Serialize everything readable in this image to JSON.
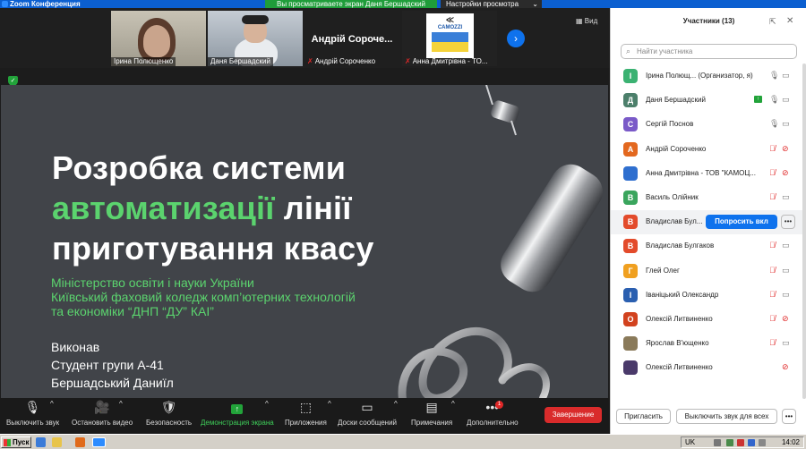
{
  "window": {
    "title": "Zoom Конференция",
    "share_banner": "Вы просматриваете экран Даня Бершадский",
    "view_options": "Настройки просмотра",
    "view_options_caret": "⌄"
  },
  "video_strip": {
    "tiles": [
      {
        "name": "Ірина Полющенко",
        "muted": false
      },
      {
        "name": "Даня Бершадский",
        "muted": false
      },
      {
        "name": "Андрій Сороченко",
        "display": "Андрій Сороче...",
        "muted": true
      },
      {
        "name": "Анна Дмитрівна - ТО...",
        "muted": true,
        "logo_title": "CAMOZZI",
        "logo_mark": "≪"
      }
    ],
    "next_icon": "›",
    "view_label": "Вид",
    "view_icon": "▦"
  },
  "slide": {
    "title_line1": "Розробка системи",
    "title_accent": "автоматизації",
    "title_line2_rest": " лінії",
    "title_line3": "приготування квасу",
    "org_line1": "Міністерство освіти і науки України",
    "org_line2": "Київський фаховий коледж комп’ютерних технологій",
    "org_line3": "та економіки “ДНП “ДУ” КАІ”",
    "author_line1": "Виконав",
    "author_line2": "Студент групи А-41",
    "author_line3": "Бершадський Даниїл"
  },
  "toolbar": {
    "items": [
      {
        "label": "Выключить звук",
        "icon": "🎙"
      },
      {
        "label": "Остановить видео",
        "icon": "🎥"
      },
      {
        "label": "Безопасность",
        "icon": "🛡"
      },
      {
        "label": "Демонстрация экрана",
        "icon": "↑"
      },
      {
        "label": "Приложения",
        "icon": "⬚"
      },
      {
        "label": "Доски сообщений",
        "icon": "▭"
      },
      {
        "label": "Примечания",
        "icon": "▤"
      },
      {
        "label": "Дополнительно",
        "icon": "•••"
      }
    ],
    "more_badge": "1",
    "end_label": "Завершение",
    "caret": "^"
  },
  "participants": {
    "header": "Участники (13)",
    "popout_icon": "⇱",
    "close_icon": "✕",
    "search_placeholder": "Найти участника",
    "search_icon": "⌕",
    "list": [
      {
        "initial": "І",
        "color": "#3bb272",
        "name": "Ірина Полющ...  (Организатор, я)",
        "mic": "on",
        "cam": "on"
      },
      {
        "initial": "Д",
        "color": "#4c7f6b",
        "name": "Даня Бершадский",
        "mic": "on",
        "cam": "on",
        "sharing": true
      },
      {
        "initial": "С",
        "color": "#7a5ac8",
        "name": "Сергій Поснов",
        "mic": "on",
        "cam": "on"
      },
      {
        "initial": "А",
        "color": "#e3681f",
        "name": "Андрій Сороченко",
        "mic": "off",
        "cam": "off"
      },
      {
        "initial": "",
        "color": "#2f6fcf",
        "name": "Анна Дмитрівна - ТОВ \"КАМОЦ...",
        "mic": "off",
        "cam": "off",
        "photo": true
      },
      {
        "initial": "В",
        "color": "#3aa55d",
        "name": "Василь Олійник",
        "mic": "off",
        "cam": "on"
      },
      {
        "initial": "В",
        "color": "#e34b2b",
        "name": "Владислав Бул...",
        "mic": "none",
        "cam": "none",
        "highlight": true,
        "ask": "Попросить вкл",
        "more": "•••"
      },
      {
        "initial": "В",
        "color": "#e34b2b",
        "name": "Владислав Булгаков",
        "mic": "off",
        "cam": "on"
      },
      {
        "initial": "Г",
        "color": "#f0a020",
        "name": "Глей Олег",
        "mic": "off",
        "cam": "on"
      },
      {
        "initial": "І",
        "color": "#2a5fb0",
        "name": "Іваніцький Олександр",
        "mic": "off",
        "cam": "on"
      },
      {
        "initial": "О",
        "color": "#d2421e",
        "name": "Олексій Литвиненко",
        "mic": "off",
        "cam": "off"
      },
      {
        "initial": "",
        "color": "#8a7a5a",
        "name": "Ярослав В'ющенко",
        "mic": "off",
        "cam": "on",
        "photo": true
      },
      {
        "initial": "",
        "color": "#4a3a6a",
        "name": "Олексій Литвиненко",
        "mic": "none",
        "cam": "off",
        "photo": true
      }
    ],
    "invite_label": "Пригласить",
    "mute_all_label": "Выключить звук для всех",
    "footer_more": "•••"
  },
  "taskbar": {
    "start_label": "Пуск",
    "language": "UK",
    "time": "14:02"
  }
}
